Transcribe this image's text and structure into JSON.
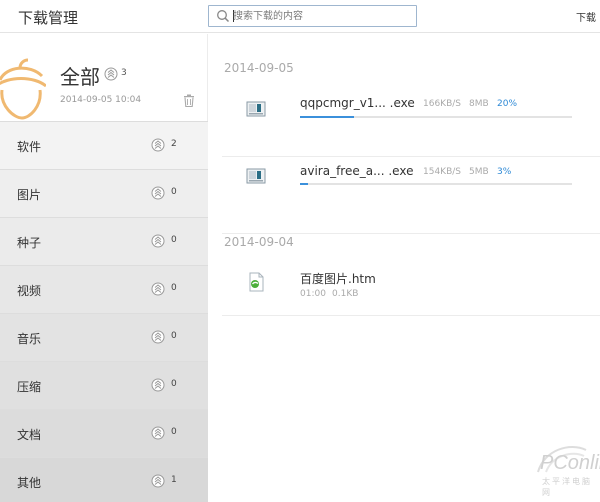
{
  "header": {
    "title": "下载管理",
    "search_placeholder": "搜索下载的内容",
    "right_label": "下载"
  },
  "sidebar": {
    "all": {
      "title": "全部",
      "count": "3",
      "date": "2014-09-05 10:04"
    },
    "categories": [
      {
        "label": "软件",
        "count": "2"
      },
      {
        "label": "图片",
        "count": "0"
      },
      {
        "label": "种子",
        "count": "0"
      },
      {
        "label": "视频",
        "count": "0"
      },
      {
        "label": "音乐",
        "count": "0"
      },
      {
        "label": "压缩",
        "count": "0"
      },
      {
        "label": "文档",
        "count": "0"
      },
      {
        "label": "其他",
        "count": "1"
      }
    ]
  },
  "groups": [
    {
      "date": "2014-09-05",
      "items": [
        {
          "name": "qqpcmgr_v1... .exe",
          "speed": "166KB/S",
          "size": "8MB",
          "percent": "20%",
          "progress": 0.2
        },
        {
          "name": "avira_free_a... .exe",
          "speed": "154KB/S",
          "size": "5MB",
          "percent": "3%",
          "progress": 0.03
        }
      ]
    },
    {
      "date": "2014-09-04",
      "items": [
        {
          "name": "百度图片.htm",
          "time": "01:00",
          "size": "0.1KB"
        }
      ]
    }
  ],
  "watermark": {
    "brand": "PConline",
    "sub": "太平洋电脑网"
  },
  "colors": {
    "accent": "#3b90db",
    "sidebar_bg": "#f1f1f1",
    "search_border": "#9fb6cf"
  }
}
